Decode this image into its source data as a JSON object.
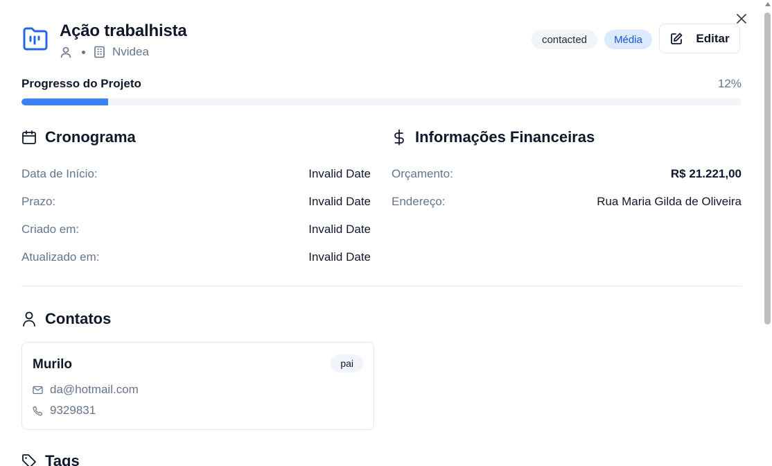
{
  "project": {
    "title": "Ação trabalhista",
    "company": "Nvidea",
    "status": "contacted",
    "priority": "Média",
    "edit_label": "Editar"
  },
  "progress": {
    "label": "Progresso do Projeto",
    "value_text": "12%",
    "percent": 12
  },
  "schedule": {
    "title": "Cronograma",
    "rows": [
      {
        "label": "Data de Início:",
        "value": "Invalid Date"
      },
      {
        "label": "Prazo:",
        "value": "Invalid Date"
      },
      {
        "label": "Criado em:",
        "value": "Invalid Date"
      },
      {
        "label": "Atualizado em:",
        "value": "Invalid Date"
      }
    ]
  },
  "financial": {
    "title": "Informações Financeiras",
    "rows": [
      {
        "label": "Orçamento:",
        "value": "R$ 21.221,00"
      },
      {
        "label": "Endereço:",
        "value": "Rua Maria Gilda de Oliveira"
      }
    ]
  },
  "contacts": {
    "title": "Contatos",
    "items": [
      {
        "name": "Murilo",
        "role": "pai",
        "email": "da@hotmail.com",
        "phone": "9329831"
      }
    ]
  },
  "tags": {
    "title": "Tags"
  },
  "colors": {
    "accent": "#3b82f6",
    "priority_bg": "#dbeafe",
    "priority_text": "#1d4ed8",
    "muted": "#64748b"
  },
  "icons": {
    "close": "close-icon",
    "project": "kanban-folder-icon",
    "user": "user-icon",
    "building": "building-icon",
    "edit": "edit-icon",
    "calendar": "calendar-icon",
    "dollar": "dollar-icon",
    "mail": "mail-icon",
    "phone": "phone-icon",
    "tag": "tag-icon"
  }
}
